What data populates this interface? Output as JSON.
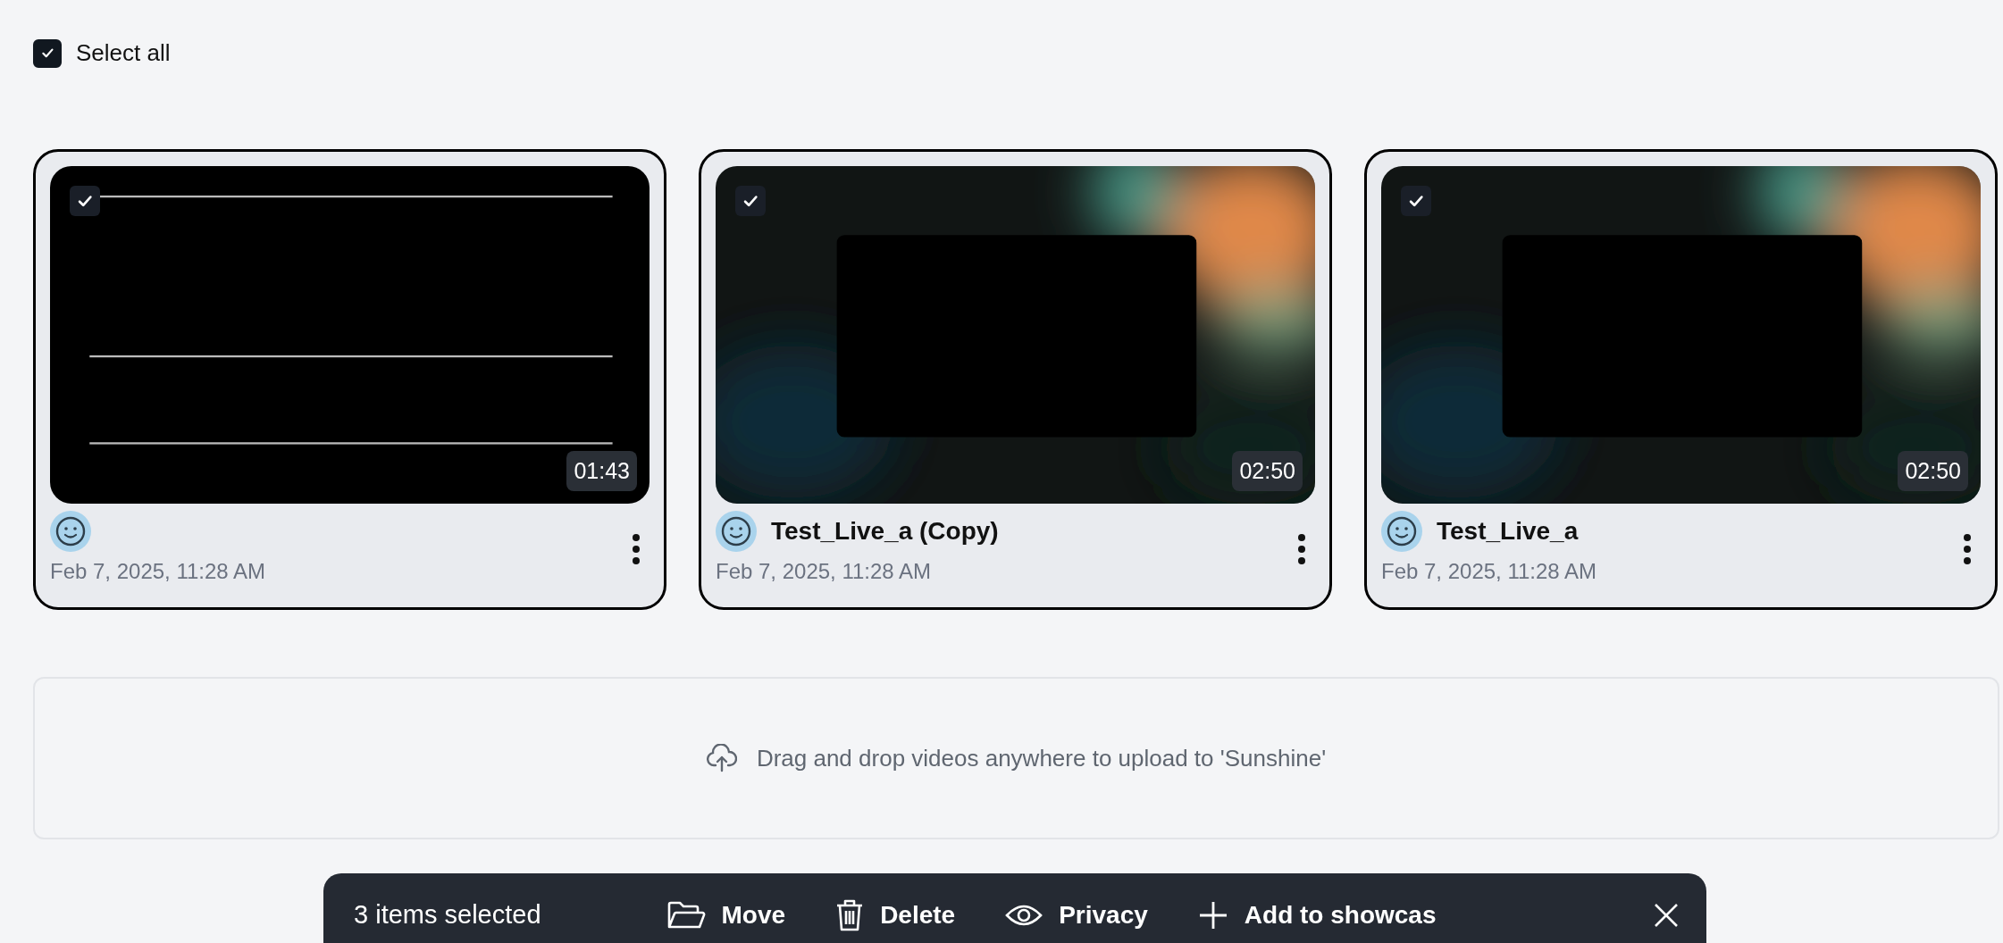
{
  "select_all": {
    "label": "Select all",
    "checked": true
  },
  "videos": [
    {
      "checked": true,
      "duration": "01:43",
      "date": "Feb 7, 2025, 11:28 AM"
    },
    {
      "checked": true,
      "duration": "02:50",
      "title": "Test_Live_a (Copy)",
      "date": "Feb 7, 2025, 11:28 AM"
    },
    {
      "checked": true,
      "duration": "02:50",
      "title": "Test_Live_a",
      "date": "Feb 7, 2025, 11:28 AM"
    }
  ],
  "drop_zone": {
    "text": "Drag and drop videos anywhere to upload to 'Sunshine'"
  },
  "selection_bar": {
    "count": "3 items selected",
    "actions": [
      {
        "label": "Move"
      },
      {
        "label": "Delete"
      },
      {
        "label": "Privacy"
      },
      {
        "label": "Add to showcas"
      }
    ]
  }
}
